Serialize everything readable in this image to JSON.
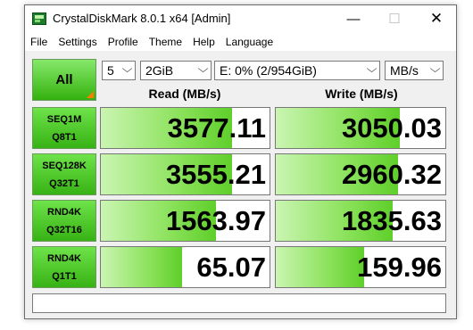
{
  "window": {
    "title": "CrystalDiskMark 8.0.1 x64 [Admin]",
    "controls": {
      "minimize": "—",
      "maximize": "☐",
      "close": "✕"
    }
  },
  "menu": [
    "File",
    "Settings",
    "Profile",
    "Theme",
    "Help",
    "Language"
  ],
  "toolbar": {
    "all_label": "All",
    "count": "5",
    "size": "2GiB",
    "drive": "E: 0% (2/954GiB)",
    "unit": "MB/s",
    "chevron": "⌵"
  },
  "headers": {
    "read": "Read (MB/s)",
    "write": "Write (MB/s)"
  },
  "tests": [
    {
      "line1": "SEQ1M",
      "line2": "Q8T1",
      "read": "3577.11",
      "write": "3050.03",
      "read_fill": 0.78,
      "write_fill": 0.73
    },
    {
      "line1": "SEQ128K",
      "line2": "Q32T1",
      "read": "3555.21",
      "write": "2960.32",
      "read_fill": 0.78,
      "write_fill": 0.72
    },
    {
      "line1": "RND4K",
      "line2": "Q32T16",
      "read": "1563.97",
      "write": "1835.63",
      "read_fill": 0.68,
      "write_fill": 0.69
    },
    {
      "line1": "RND4K",
      "line2": "Q1T1",
      "read": "65.07",
      "write": "159.96",
      "read_fill": 0.48,
      "write_fill": 0.52
    }
  ],
  "status": ""
}
